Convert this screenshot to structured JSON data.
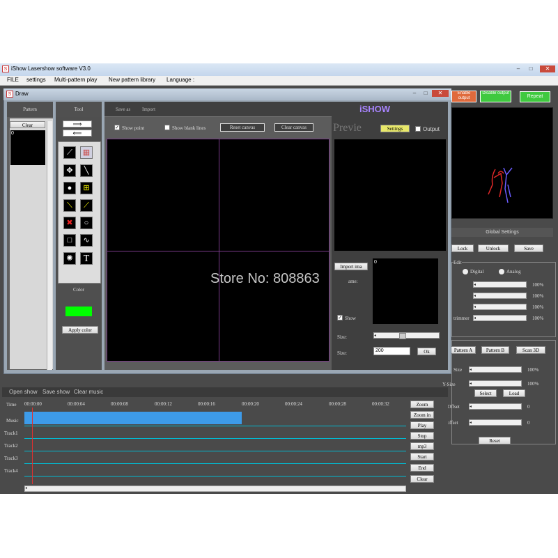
{
  "app": {
    "title": "iShow Lasershow software V3.0",
    "menu": [
      "FILE",
      "settings",
      "Multi-pattern play",
      "New pattern library",
      "Language :"
    ],
    "controls": {
      "min": "–",
      "max": "□",
      "close": "✕"
    }
  },
  "right_panel": {
    "enable_output": "Enable output",
    "disable_output": "Disable output",
    "repeat": "Repeat",
    "global_settings": "Global Settings",
    "lock": "Lock",
    "unlock": "Unlock",
    "save": "Save",
    "edit_label": "Edit",
    "digital": "Digital",
    "analog": "Analog",
    "percents": [
      "100%",
      "100%",
      "100%",
      "100%"
    ],
    "slider_fourth_label": "trimmer",
    "mid_buttons": [
      "Pattern A",
      "Pattern B",
      "Scan 3D"
    ],
    "size_label": "Size",
    "size_pct": "100%",
    "ysize_label": "Y-Size",
    "ysize_pct": "100%",
    "ok1": "Select",
    "ok2": "Load",
    "xoffset_label": "X-Offset",
    "xoffset_val": "0",
    "yoffset_label": "Y-offset",
    "yoffset_val": "0",
    "reset": "Reset",
    "colors": {
      "enable": "#e06a3c",
      "green": "#3fc93f"
    }
  },
  "draw": {
    "title": "Draw",
    "pattern_header": "Pattern",
    "tool_header": "Tool",
    "clear": "Clear",
    "pattern_item": "0",
    "save_as": "Save as",
    "import": "Import",
    "show_point": "Show point",
    "show_blank_lines": "Show blank lines",
    "reset_canvas": "Reset canvas",
    "clear_canvas": "Clear canvas",
    "color_label": "Color",
    "apply_color": "Apply color",
    "brand": "iSHOW",
    "preview": "Previe",
    "settings": "Settings",
    "output": "Output",
    "import_ima": "Import ima",
    "name_label": "ame:",
    "image_item": "0",
    "show": "Show",
    "size_label_1": "Size:",
    "size_label_2": "Size:",
    "size_value": "200",
    "ok": "Ok",
    "watermark": "Store No: 808863",
    "tool_icons": [
      "pen-icon",
      "eraser-icon",
      "move-icon",
      "line-icon",
      "dot-icon",
      "fill-icon",
      "brush-icon",
      "picker-icon",
      "delete-icon",
      "circle-icon",
      "square-icon",
      "wave-icon",
      "star-icon",
      "text-icon"
    ],
    "colors": {
      "swatch": "#00ff00",
      "brand": "#a884ff"
    }
  },
  "timeline": {
    "menu": [
      "Open show",
      "Save show",
      "Clear music"
    ],
    "time_label": "Time",
    "times": [
      "00:00:00",
      "00:00:04",
      "00:00:08",
      "00:00:12",
      "00:00:16",
      "00:00:20",
      "00:00:24",
      "00:00:28",
      "00:00:32"
    ],
    "tracks": [
      "Music",
      "Track1",
      "Track2",
      "Track3",
      "Track4"
    ],
    "buttons": [
      "Zoom",
      "Zoom in",
      "Play",
      "Stop",
      "mp3",
      "Start",
      "End",
      "Clear"
    ],
    "colors": {
      "music": "#3d9be9",
      "track_line": "#00bcd4",
      "cursor": "#e03030"
    }
  }
}
